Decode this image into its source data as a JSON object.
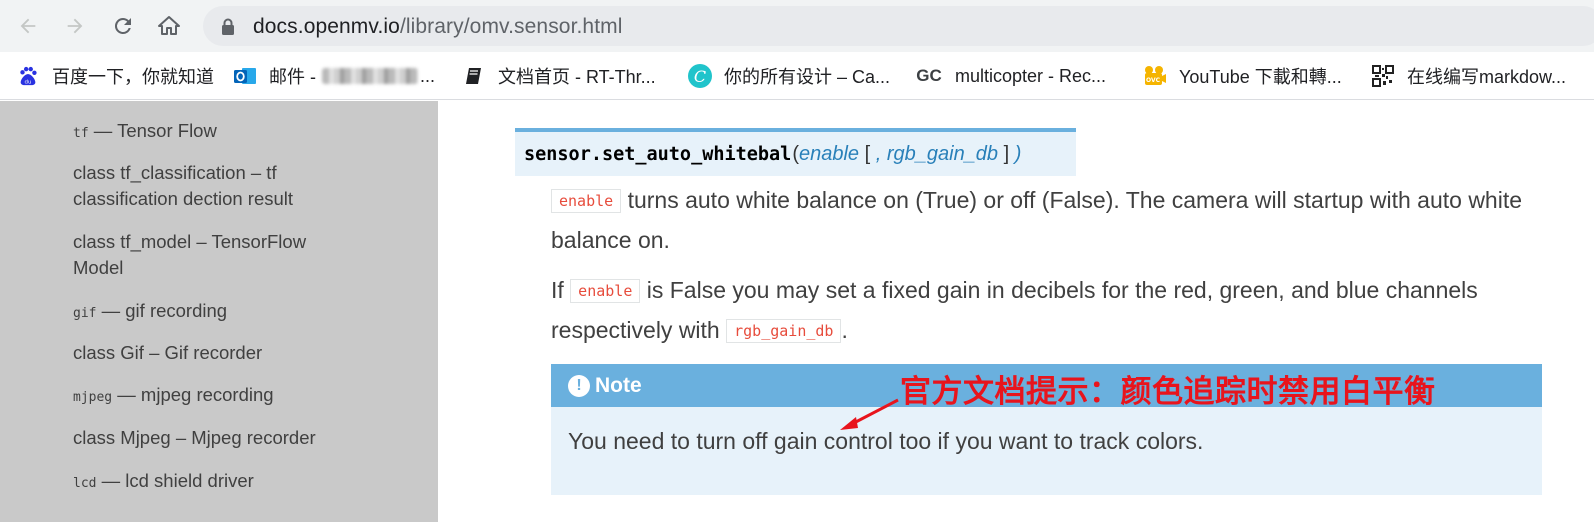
{
  "browser": {
    "url_host": "docs.openmv.io",
    "url_path": "/library/omv.sensor.html",
    "nav": [
      "back-icon",
      "forward-icon",
      "reload-icon",
      "home-icon",
      "lock-icon"
    ]
  },
  "bookmarks": [
    {
      "label": "百度一下，你就知道",
      "icon": "baidu-icon"
    },
    {
      "label_prefix": "邮件 - ",
      "label_suffix": "...",
      "icon": "outlook-icon"
    },
    {
      "label": "文档首页 - RT-Thr...",
      "icon": "book-icon"
    },
    {
      "label": "你的所有设计 – Ca...",
      "icon": "canva-icon"
    },
    {
      "label": "multicopter - Rec...",
      "icon": "gc-icon",
      "icon_text": "GC"
    },
    {
      "label": "YouTube 下載和轉...",
      "icon": "video-download-icon"
    },
    {
      "label": "在线编写markdow...",
      "icon": "qr-icon"
    }
  ],
  "sidebar": {
    "items": [
      {
        "code": "tf",
        "text": " — Tensor Flow"
      },
      {
        "text": "class tf_classification – tf classification dection result"
      },
      {
        "text": "class tf_model – TensorFlow Model"
      },
      {
        "code": "gif",
        "text": " — gif recording"
      },
      {
        "text": "class Gif – Gif recorder"
      },
      {
        "code": "mjpeg",
        "text": " — mjpeg recording"
      },
      {
        "text": "class Mjpeg – Mjpeg recorder"
      },
      {
        "code": "lcd",
        "text": " — lcd shield driver"
      }
    ]
  },
  "doc": {
    "signature": {
      "name": "sensor.set_auto_whitebal",
      "open": "(",
      "param1": "enable",
      "bracket_open": " [ ",
      "comma": ", ",
      "param2": "rgb_gain_db",
      "bracket_close": " ] ",
      "close": ")"
    },
    "para1": {
      "literal": "enable",
      "text": " turns auto white balance on (True) or off (False). The camera will startup with auto white balance on."
    },
    "para2": {
      "before": "If ",
      "literal1": "enable",
      "middle": " is False you may set a fixed gain in decibels for the red, green, and blue channels respectively with ",
      "literal2": "rgb_gain_db",
      "after": "."
    },
    "note": {
      "icon": "!",
      "title": "Note",
      "body": "You need to turn off gain control too if you want to track colors."
    }
  },
  "annotation": {
    "text": "官方文档提示：颜色追踪时禁用白平衡",
    "color": "#e8141c"
  },
  "colors": {
    "sidebar_bg": "#c9c9c9",
    "accent": "#6ab0de",
    "note_bg": "#e7f2fa",
    "param_color": "#2980b9",
    "literal_color": "#e74c3c"
  }
}
